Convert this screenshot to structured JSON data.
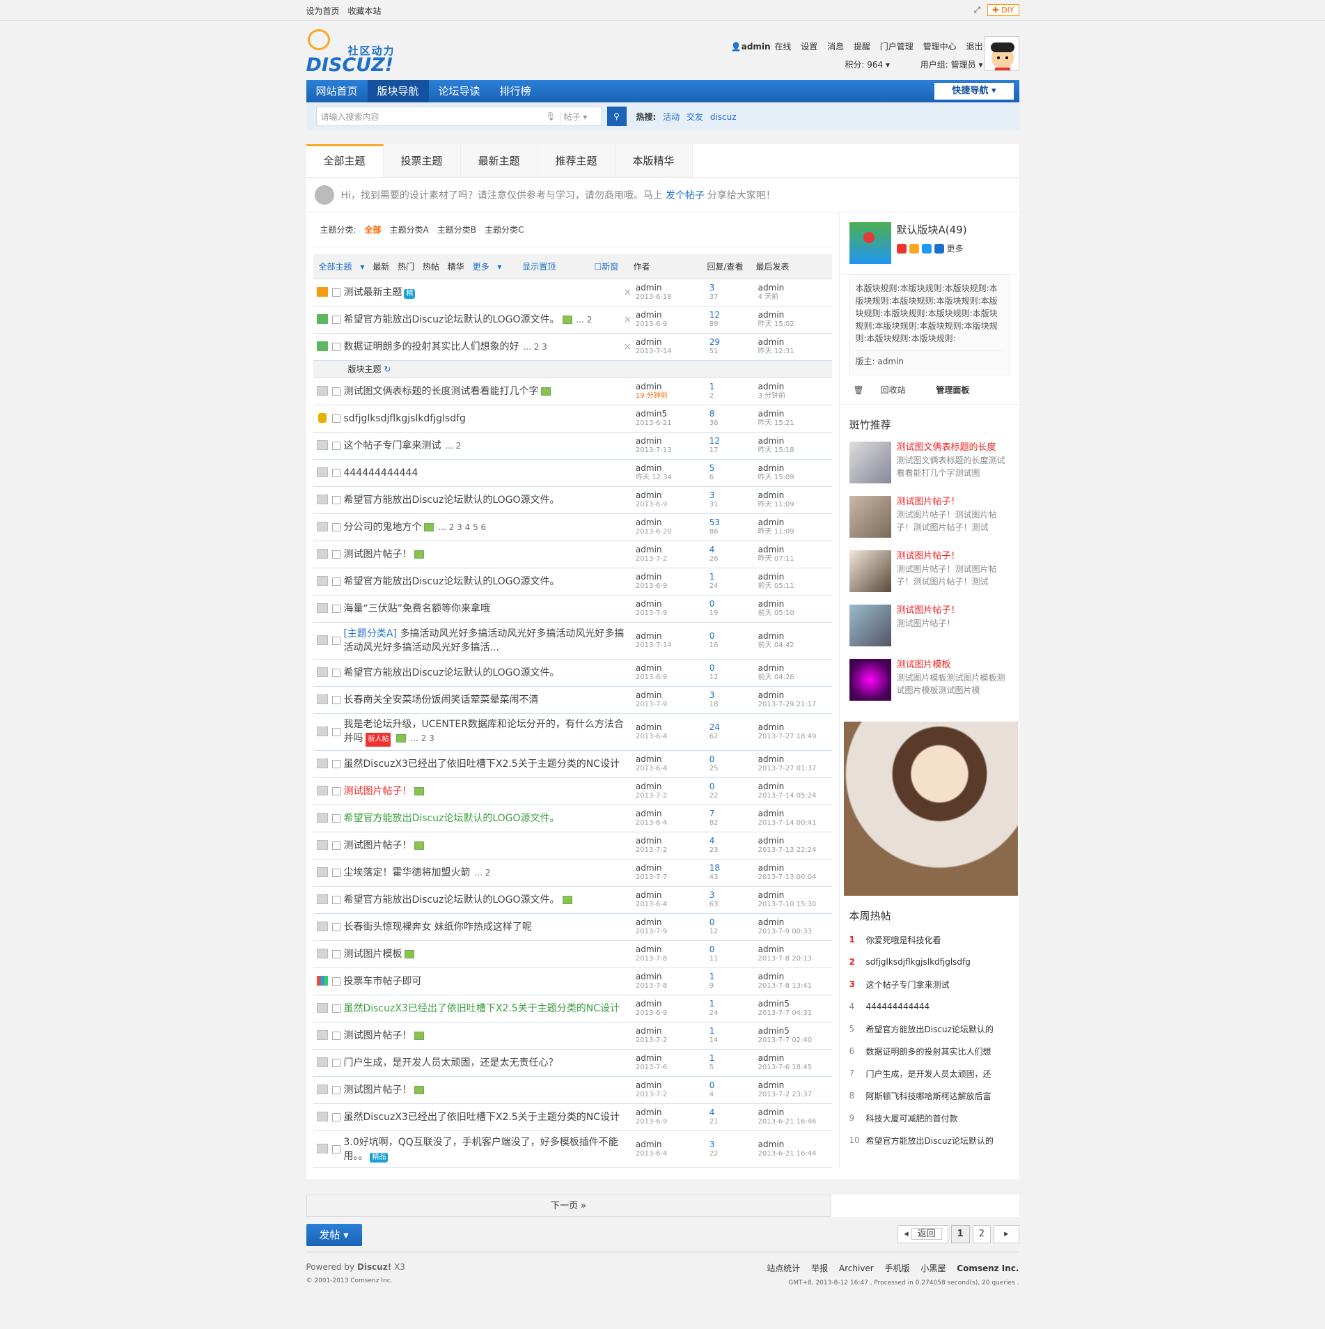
{
  "topbar": {
    "left": [
      "设为首页",
      "收藏本站"
    ],
    "diy": "DIY"
  },
  "logo": {
    "cn": "社区动力",
    "en": "DISCUZ!"
  },
  "user": {
    "name": "admin",
    "status": "在线",
    "links": [
      "设置",
      "消息",
      "提醒",
      "门户管理",
      "管理中心",
      "退出"
    ],
    "points": "积分: 964",
    "group": "用户组: 管理员"
  },
  "nav": {
    "items": [
      "网站首页",
      "版块导航",
      "论坛导读",
      "排行榜"
    ],
    "quick": "快捷导航"
  },
  "search": {
    "placeholder": "请输入搜索内容",
    "type": "帖子",
    "hot_label": "热搜:",
    "hot": [
      "活动",
      "交友",
      "discuz"
    ]
  },
  "tabs": [
    "全部主题",
    "投票主题",
    "最新主题",
    "推荐主题",
    "本版精华"
  ],
  "tips": {
    "pre": "Hi，找到需要的设计素材了吗？请注意仅供参考与学习，请勿商用哦。马上",
    "link": "发个帖子",
    "post": "分享给大家吧！"
  },
  "cats": {
    "label": "主题分类:",
    "items": [
      "全部",
      "主题分类A",
      "主题分类B",
      "主题分类C"
    ]
  },
  "thead": {
    "filters": [
      "全部主题",
      "最新",
      "热门",
      "热帖",
      "精华",
      "更多"
    ],
    "show_top": "显示置顶",
    "new": "新窗",
    "author": "作者",
    "reply": "回复/查看",
    "last": "最后发表"
  },
  "section": "版块主题",
  "top_threads": [
    {
      "icon": "top",
      "title": "测试最新主题",
      "badge": "精",
      "pages": "",
      "a": "admin",
      "ad": "2013-6-18",
      "r": "3",
      "v": "37",
      "l": "admin",
      "ld": "4 天前"
    },
    {
      "icon": "top-g",
      "title": "希望官方能放出Discuz论坛默认的LOGO源文件。",
      "img": true,
      "pages": "... 2",
      "a": "admin",
      "ad": "2013-6-9",
      "r": "12",
      "v": "89",
      "l": "admin",
      "ld": "昨天 15:02"
    },
    {
      "icon": "top-g",
      "title": "数据证明朗多的投射其实比人们想象的好",
      "pages": "... 2  3",
      "a": "admin",
      "ad": "2013-7-14",
      "r": "29",
      "v": "51",
      "l": "admin",
      "ld": "昨天 12:31"
    }
  ],
  "threads": [
    {
      "title": "测试图文俩表标题的长度测试看看能打几个字",
      "img": true,
      "a": "admin",
      "ad": "19 分钟前",
      "adred": true,
      "r": "1",
      "v": "2",
      "l": "admin",
      "ld": "3 分钟前"
    },
    {
      "icon": "lock",
      "title": "sdfjglksdjflkgjslkdfjglsdfg",
      "a": "admin5",
      "ad": "2013-6-21",
      "r": "8",
      "v": "36",
      "l": "admin",
      "ld": "昨天 15:21"
    },
    {
      "title": "这个帖子专门拿来测试",
      "pages": "... 2",
      "a": "admin",
      "ad": "2013-7-13",
      "r": "12",
      "v": "17",
      "l": "admin",
      "ld": "昨天 15:18"
    },
    {
      "title": "444444444444",
      "a": "admin",
      "ad": "昨天 12:34",
      "r": "5",
      "v": "6",
      "l": "admin",
      "ld": "昨天 15:09"
    },
    {
      "title": "希望官方能放出Discuz论坛默认的LOGO源文件。",
      "a": "admin",
      "ad": "2013-6-9",
      "r": "3",
      "v": "31",
      "l": "admin",
      "ld": "昨天 11:09"
    },
    {
      "title": "分公司的鬼地方个",
      "img": true,
      "pages": "... 2  3  4  5  6",
      "a": "admin",
      "ad": "2013-6-20",
      "r": "53",
      "v": "86",
      "l": "admin",
      "ld": "昨天 11:09"
    },
    {
      "title": "测试图片帖子！",
      "img": true,
      "a": "admin",
      "ad": "2013-7-2",
      "r": "4",
      "v": "26",
      "l": "admin",
      "ld": "昨天 07:11"
    },
    {
      "title": "希望官方能放出Discuz论坛默认的LOGO源文件。",
      "a": "admin",
      "ad": "2013-6-9",
      "r": "1",
      "v": "24",
      "l": "admin",
      "ld": "前天 05:11"
    },
    {
      "title": "海量“三伏贴”免费名额等你来拿哦",
      "a": "admin",
      "ad": "2013-7-9",
      "r": "0",
      "v": "19",
      "l": "admin",
      "ld": "前天 05:10"
    },
    {
      "tall": true,
      "sort": "[主题分类A]",
      "title": "多搞活动风光好多搞活动风光好多搞活动风光好多搞活动风光好多搞活动风光好多搞活...",
      "a": "admin",
      "ad": "2013-7-14",
      "r": "0",
      "v": "16",
      "l": "admin",
      "ld": "前天 04:42"
    },
    {
      "title": "希望官方能放出Discuz论坛默认的LOGO源文件。",
      "a": "admin",
      "ad": "2013-6-9",
      "r": "0",
      "v": "12",
      "l": "admin",
      "ld": "前天 04:26"
    },
    {
      "title": "长春南关全安菜场份饭闹笑话荤菜晕菜闹不清",
      "a": "admin",
      "ad": "2013-7-9",
      "r": "3",
      "v": "18",
      "l": "admin",
      "ld": "2013-7-29 21:17"
    },
    {
      "tall": true,
      "title": "我是老论坛升级，UCENTER数据库和论坛分开的，有什么方法合并吗",
      "nb": "新人帖",
      "img": true,
      "pages": "... 2  3",
      "a": "admin",
      "ad": "2013-6-4",
      "r": "24",
      "v": "62",
      "l": "admin",
      "ld": "2013-7-27 18:49"
    },
    {
      "title": "虽然DiscuzX3已经出了依旧吐槽下X2.5关于主题分类的NC设计",
      "a": "admin",
      "ad": "2013-6-4",
      "r": "0",
      "v": "25",
      "l": "admin",
      "ld": "2013-7-27 01:37"
    },
    {
      "color": "red",
      "title": "测试图片帖子！",
      "img": true,
      "a": "admin",
      "ad": "2013-7-2",
      "r": "0",
      "v": "22",
      "l": "admin",
      "ld": "2013-7-14 05:24"
    },
    {
      "color": "green",
      "title": "希望官方能放出Discuz论坛默认的LOGO源文件。",
      "a": "admin",
      "ad": "2013-6-4",
      "r": "7",
      "v": "82",
      "l": "admin",
      "ld": "2013-7-14 00:41"
    },
    {
      "title": "测试图片帖子！",
      "img": true,
      "a": "admin",
      "ad": "2013-7-2",
      "r": "4",
      "v": "23",
      "l": "admin",
      "ld": "2013-7-13 22:24"
    },
    {
      "title": "尘埃落定！霍华德将加盟火箭",
      "pages": "... 2",
      "a": "admin",
      "ad": "2013-7-7",
      "r": "18",
      "v": "43",
      "l": "admin",
      "ld": "2013-7-13 00:04"
    },
    {
      "title": "希望官方能放出Discuz论坛默认的LOGO源文件。",
      "img": true,
      "a": "admin",
      "ad": "2013-6-4",
      "r": "3",
      "v": "63",
      "l": "admin",
      "ld": "2013-7-10 15:30"
    },
    {
      "title": "长春街头惊现裸奔女 妹纸你咋热成这样了呢",
      "a": "admin",
      "ad": "2013-7-9",
      "r": "0",
      "v": "12",
      "l": "admin",
      "ld": "2013-7-9 00:33"
    },
    {
      "title": "测试图片模板",
      "img": true,
      "a": "admin",
      "ad": "2013-7-8",
      "r": "0",
      "v": "11",
      "l": "admin",
      "ld": "2013-7-8 20:13"
    },
    {
      "icon": "poll",
      "title": "投票车市帖子即可",
      "a": "admin",
      "ad": "2013-7-8",
      "r": "1",
      "v": "9",
      "l": "admin",
      "ld": "2013-7-8 13:41"
    },
    {
      "color": "green",
      "title": "虽然DiscuzX3已经出了依旧吐槽下X2.5关于主题分类的NC设计",
      "a": "admin",
      "ad": "2013-6-9",
      "r": "1",
      "v": "24",
      "l": "admin5",
      "ld": "2013-7-7 04:31"
    },
    {
      "title": "测试图片帖子！",
      "img": true,
      "a": "admin",
      "ad": "2013-7-2",
      "r": "1",
      "v": "14",
      "l": "admin5",
      "ld": "2013-7-7 02:40"
    },
    {
      "title": "门户生成，是开发人员太顽固，还是太无责任心？",
      "a": "admin",
      "ad": "2013-7-6",
      "r": "1",
      "v": "5",
      "l": "admin",
      "ld": "2013-7-6 18:45"
    },
    {
      "title": "测试图片帖子！",
      "img": true,
      "a": "admin",
      "ad": "2013-7-2",
      "r": "0",
      "v": "4",
      "l": "admin",
      "ld": "2013-7-2 23:37"
    },
    {
      "title": "虽然DiscuzX3已经出了依旧吐槽下X2.5关于主题分类的NC设计",
      "a": "admin",
      "ad": "2013-6-9",
      "r": "4",
      "v": "21",
      "l": "admin",
      "ld": "2013-6-21 16:46"
    },
    {
      "tall": true,
      "title": "3.0好坑啊，QQ互联没了，手机客户端没了，好多模板插件不能用。。",
      "badge": "精品",
      "a": "admin",
      "ad": "2013-6-4",
      "r": "3",
      "v": "22",
      "l": "admin",
      "ld": "2013-6-21 16:44"
    }
  ],
  "more": "下一页 »",
  "post_btn": "发帖",
  "pager": {
    "back": "返回",
    "pages": [
      "1",
      "2"
    ]
  },
  "side": {
    "forum_name": "默认版块A(49)",
    "more": "更多",
    "rules": "本版块规则:本版块规则:本版块规则:本版块规则:本版块规则:本版块规则:本版块规则:本版块规则:本版块规则:本版块规则:本版块规则:本版块规则:本版块规则:本版块规则:本版块规则:",
    "mod": "版主: admin",
    "recycle": "回收站",
    "manage": "管理面板",
    "rec_title": "斑竹推荐",
    "rec": [
      {
        "t": "测试图文俩表标题的长度",
        "d": "测试图文俩表标题的长度测试看看能打几个字测试图"
      },
      {
        "t": "测试图片帖子！",
        "d": "测试图片帖子！测试图片帖子！测试图片帖子！测试"
      },
      {
        "t": "测试图片帖子！",
        "d": "测试图片帖子！测试图片帖子！测试图片帖子！测试"
      },
      {
        "t": "测试图片帖子！",
        "d": "测试图片帖子！"
      },
      {
        "t": "测试图片模板",
        "d": "测试图片模板测试图片模板测试图片模板测试图片模"
      }
    ],
    "hot_title": "本周热帖",
    "hot": [
      "你爱死哦是科技化看",
      "sdfjglksdjflkgjslkdfjglsdfg",
      "这个帖子专门拿来测试",
      "444444444444",
      "希望官方能放出Discuz论坛默认的",
      "数据证明朗多的投射其实比人们想",
      "门户生成，是开发人员太顽固，还",
      "阿斯顿飞科技哪哈斯柯达解放后富",
      "科技大厦可减肥的首付款",
      "希望官方能放出Discuz论坛默认的"
    ]
  },
  "footer": {
    "powered": "Powered by",
    "brand": "Discuz!",
    "ver": "X3",
    "copy": "© 2001-2013 Comsenz Inc.",
    "links": [
      "站点统计",
      "举报",
      "Archiver",
      "手机版",
      "小黑屋",
      "Comsenz Inc."
    ],
    "info": "GMT+8, 2013-8-12 16:47 , Processed in 0.274058 second(s), 20 queries ."
  }
}
